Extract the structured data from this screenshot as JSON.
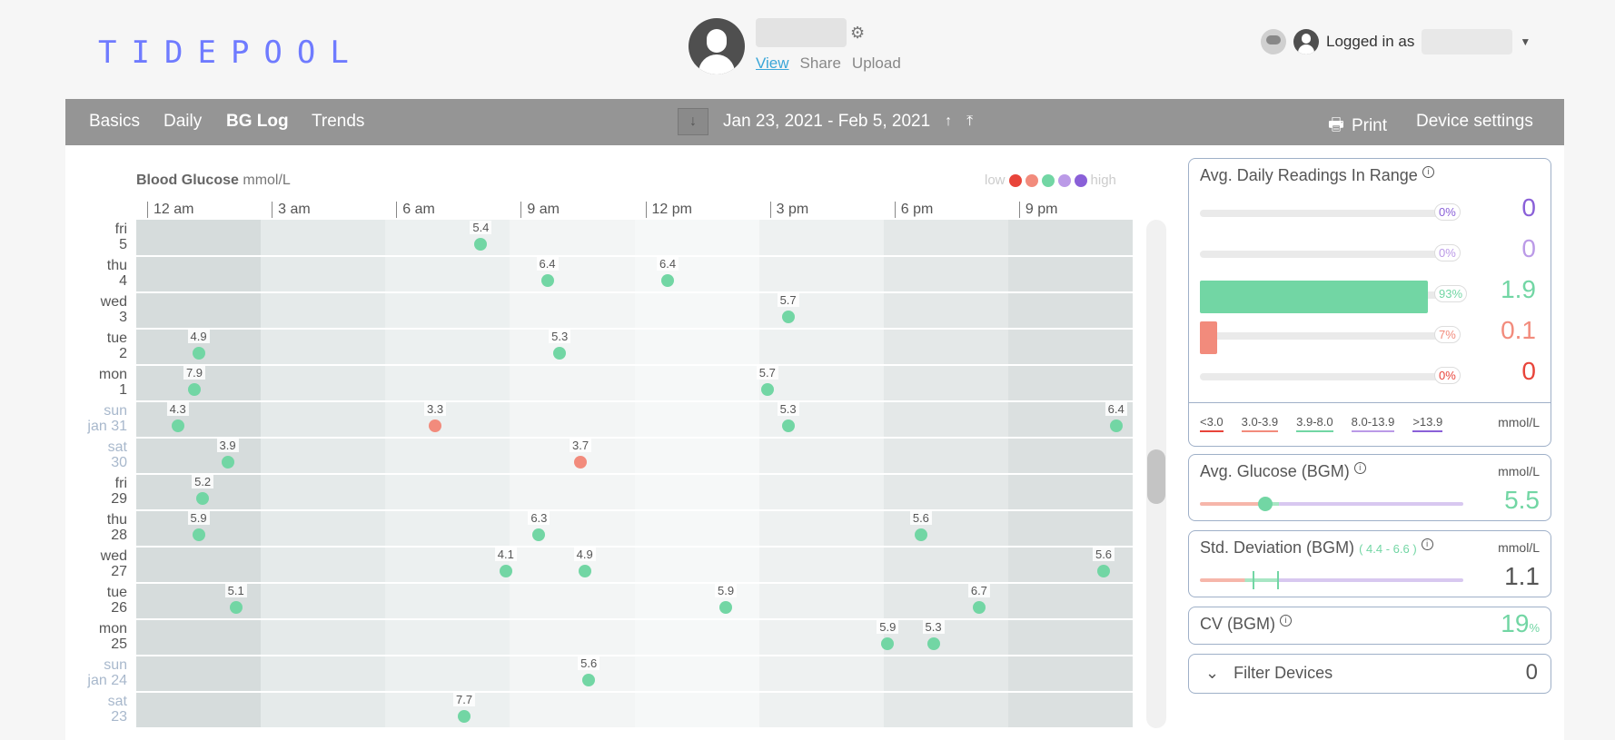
{
  "header": {
    "logo_letters": [
      "T",
      "I",
      "D",
      "E",
      "P",
      "O",
      "O",
      "L"
    ],
    "patient_links": [
      "View",
      "Share",
      "Upload"
    ],
    "user_label": "Logged in as"
  },
  "nav": {
    "tabs": [
      "Basics",
      "Daily",
      "BG Log",
      "Trends"
    ],
    "active_tab": "BG Log",
    "date_range": "Jan 23, 2021 - Feb 5, 2021",
    "print_label": "Print",
    "device_settings_label": "Device settings"
  },
  "chart": {
    "title": "Blood Glucose",
    "units": "mmol/L",
    "legend_low": "low",
    "legend_high": "high",
    "legend_colors": [
      "#e8443a",
      "#f28b7c",
      "#72d6a4",
      "#bb9ae7",
      "#8a60d8"
    ]
  },
  "chart_data": {
    "type": "scatter",
    "x_hours": [
      "12 am",
      "3 am",
      "6 am",
      "9 am",
      "12 pm",
      "3 pm",
      "6 pm",
      "9 pm"
    ],
    "days": [
      {
        "day": "fri",
        "date": "5",
        "weekend": false
      },
      {
        "day": "thu",
        "date": "4",
        "weekend": false
      },
      {
        "day": "wed",
        "date": "3",
        "weekend": false
      },
      {
        "day": "tue",
        "date": "2",
        "weekend": false
      },
      {
        "day": "mon",
        "date": "1",
        "weekend": false
      },
      {
        "day": "sun",
        "date": "jan 31",
        "weekend": true
      },
      {
        "day": "sat",
        "date": "30",
        "weekend": true
      },
      {
        "day": "fri",
        "date": "29",
        "weekend": false
      },
      {
        "day": "thu",
        "date": "28",
        "weekend": false
      },
      {
        "day": "wed",
        "date": "27",
        "weekend": false
      },
      {
        "day": "tue",
        "date": "26",
        "weekend": false
      },
      {
        "day": "mon",
        "date": "25",
        "weekend": false
      },
      {
        "day": "sun",
        "date": "jan 24",
        "weekend": true
      },
      {
        "day": "sat",
        "date": "23",
        "weekend": true
      }
    ],
    "readings": [
      {
        "row": 0,
        "hour": 8.3,
        "value": "5.4",
        "color": "#72d6a4"
      },
      {
        "row": 1,
        "hour": 9.9,
        "value": "6.4",
        "color": "#72d6a4"
      },
      {
        "row": 1,
        "hour": 12.8,
        "value": "6.4",
        "color": "#72d6a4"
      },
      {
        "row": 2,
        "hour": 15.7,
        "value": "5.7",
        "color": "#72d6a4"
      },
      {
        "row": 3,
        "hour": 1.5,
        "value": "4.9",
        "color": "#72d6a4"
      },
      {
        "row": 3,
        "hour": 10.2,
        "value": "5.3",
        "color": "#72d6a4"
      },
      {
        "row": 4,
        "hour": 1.4,
        "value": "7.9",
        "color": "#72d6a4"
      },
      {
        "row": 4,
        "hour": 15.2,
        "value": "5.7",
        "color": "#72d6a4"
      },
      {
        "row": 5,
        "hour": 1.0,
        "value": "4.3",
        "color": "#72d6a4"
      },
      {
        "row": 5,
        "hour": 7.2,
        "value": "3.3",
        "color": "#f28b7c"
      },
      {
        "row": 5,
        "hour": 15.7,
        "value": "5.3",
        "color": "#72d6a4"
      },
      {
        "row": 5,
        "hour": 23.6,
        "value": "6.4",
        "color": "#72d6a4"
      },
      {
        "row": 6,
        "hour": 2.2,
        "value": "3.9",
        "color": "#72d6a4"
      },
      {
        "row": 6,
        "hour": 10.7,
        "value": "3.7",
        "color": "#f28b7c"
      },
      {
        "row": 7,
        "hour": 1.6,
        "value": "5.2",
        "color": "#72d6a4"
      },
      {
        "row": 8,
        "hour": 1.5,
        "value": "5.9",
        "color": "#72d6a4"
      },
      {
        "row": 8,
        "hour": 9.7,
        "value": "6.3",
        "color": "#72d6a4"
      },
      {
        "row": 8,
        "hour": 18.9,
        "value": "5.6",
        "color": "#72d6a4"
      },
      {
        "row": 9,
        "hour": 8.9,
        "value": "4.1",
        "color": "#72d6a4"
      },
      {
        "row": 9,
        "hour": 10.8,
        "value": "4.9",
        "color": "#72d6a4"
      },
      {
        "row": 9,
        "hour": 23.3,
        "value": "5.6",
        "color": "#72d6a4"
      },
      {
        "row": 10,
        "hour": 2.4,
        "value": "5.1",
        "color": "#72d6a4"
      },
      {
        "row": 10,
        "hour": 14.2,
        "value": "5.9",
        "color": "#72d6a4"
      },
      {
        "row": 10,
        "hour": 20.3,
        "value": "6.7",
        "color": "#72d6a4"
      },
      {
        "row": 11,
        "hour": 18.1,
        "value": "5.9",
        "color": "#72d6a4"
      },
      {
        "row": 11,
        "hour": 19.2,
        "value": "5.3",
        "color": "#72d6a4"
      },
      {
        "row": 12,
        "hour": 10.9,
        "value": "5.6",
        "color": "#72d6a4"
      },
      {
        "row": 13,
        "hour": 7.9,
        "value": "7.7",
        "color": "#72d6a4"
      }
    ]
  },
  "stats": {
    "readings_in_range": {
      "title": "Avg. Daily Readings In Range",
      "rows": [
        {
          "pct": "0%",
          "value": "0",
          "fraction": 0,
          "color": "#8a60d8"
        },
        {
          "pct": "0%",
          "value": "0",
          "fraction": 0,
          "color": "#bb9ae7"
        },
        {
          "pct": "93%",
          "value": "1.9",
          "fraction": 0.93,
          "color": "#72d6a4"
        },
        {
          "pct": "7%",
          "value": "0.1",
          "fraction": 0.07,
          "color": "#f28b7c"
        },
        {
          "pct": "0%",
          "value": "0",
          "fraction": 0,
          "color": "#e8443a"
        }
      ],
      "ranges": [
        {
          "label": "<3.0",
          "color": "#e8443a"
        },
        {
          "label": "3.0-3.9",
          "color": "#f28b7c"
        },
        {
          "label": "3.9-8.0",
          "color": "#72d6a4"
        },
        {
          "label": "8.0-13.9",
          "color": "#bb9ae7"
        },
        {
          "label": ">13.9",
          "color": "#8a60d8"
        }
      ],
      "units": "mmol/L"
    },
    "avg_glucose": {
      "title": "Avg. Glucose (BGM)",
      "units": "mmol/L",
      "value": "5.5"
    },
    "std_dev": {
      "title": "Std. Deviation (BGM)",
      "range": "( 4.4 - 6.6 )",
      "units": "mmol/L",
      "value": "1.1"
    },
    "cv": {
      "title": "CV (BGM)",
      "value": "19",
      "unit": "%"
    },
    "filter": {
      "title": "Filter Devices",
      "value": "0"
    }
  }
}
